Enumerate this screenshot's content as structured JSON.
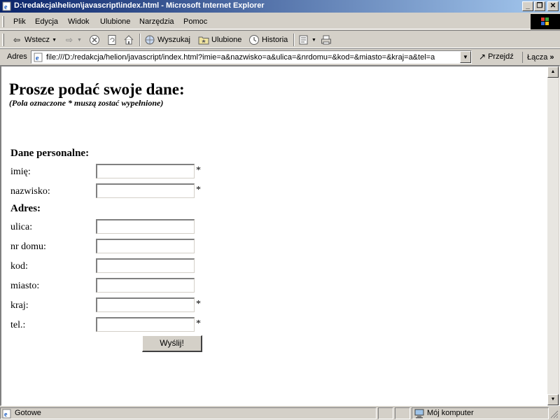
{
  "window": {
    "title": "D:\\redakcja\\helion\\javascript\\index.html - Microsoft Internet Explorer",
    "minimize": "_",
    "maximize": "❐",
    "close": "✕"
  },
  "menubar": {
    "items": [
      "Plik",
      "Edycja",
      "Widok",
      "Ulubione",
      "Narzędzia",
      "Pomoc"
    ]
  },
  "toolbar": {
    "back_label": "Wstecz",
    "search_label": "Wyszukaj",
    "favorites_label": "Ulubione",
    "history_label": "Historia"
  },
  "addressbar": {
    "label": "Adres",
    "url": "file:///D:/redakcja/helion/javascript/index.html?imie=a&nazwisko=a&ulica=&nrdomu=&kod=&miasto=&kraj=a&tel=a",
    "go_label": "Przejdź",
    "links_label": "Łącza"
  },
  "page": {
    "heading": "Prosze podać swoje dane:",
    "subtitle": "(Pola oznaczone * muszą zostać wypełnione)",
    "personal_section": "Dane personalne:",
    "address_section": "Adres:",
    "fields": {
      "imie": {
        "label": "imię:",
        "value": "",
        "required": "*"
      },
      "nazwisko": {
        "label": "nazwisko:",
        "value": "",
        "required": "*"
      },
      "ulica": {
        "label": "ulica:",
        "value": ""
      },
      "nrdomu": {
        "label": "nr domu:",
        "value": ""
      },
      "kod": {
        "label": "kod:",
        "value": ""
      },
      "miasto": {
        "label": "miasto:",
        "value": ""
      },
      "kraj": {
        "label": "kraj:",
        "value": "",
        "required": "*"
      },
      "tel": {
        "label": "tel.:",
        "value": "",
        "required": "*"
      }
    },
    "submit_label": "Wyślij!"
  },
  "statusbar": {
    "status": "Gotowe",
    "zone": "Mój komputer"
  },
  "colors": {
    "titlebar_start": "#0a246a",
    "titlebar_end": "#a6caf0",
    "chrome": "#d4d0c8"
  }
}
